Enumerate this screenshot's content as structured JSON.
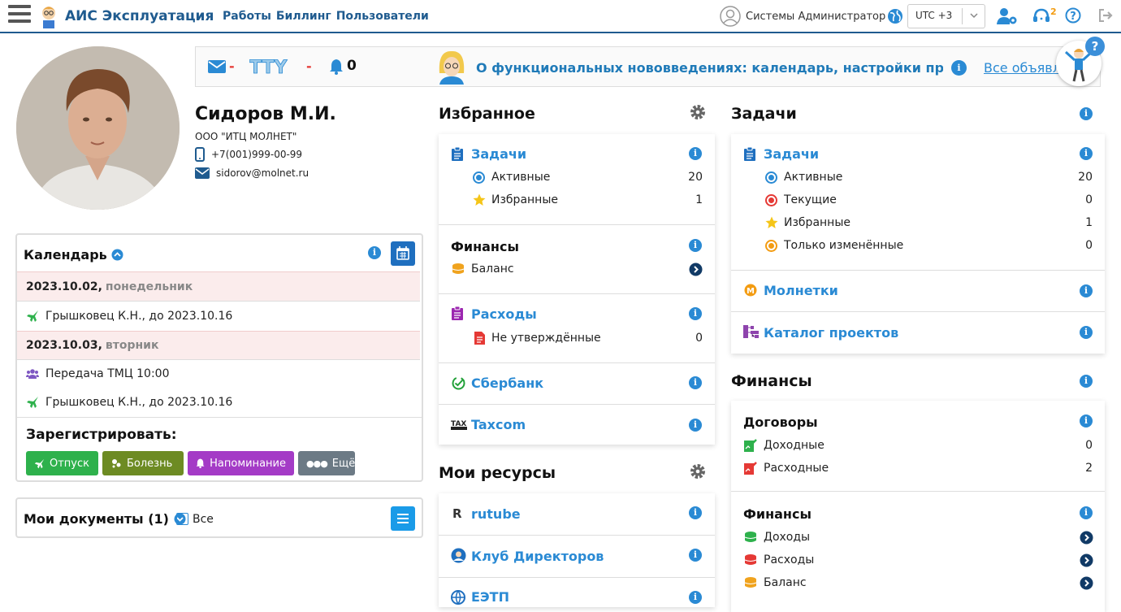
{
  "app": {
    "title": "АИС Эксплуатация"
  },
  "nav": [
    "Работы",
    "Биллинг",
    "Пользователи"
  ],
  "user": {
    "name": "Системы Администратор",
    "timezone": "UTC +3",
    "support_count": "2"
  },
  "banner": {
    "mail_count": "-",
    "tty_count": "-",
    "bell_count": "0",
    "announcement": "О функциональных нововведениях: календарь, настройки про...",
    "all_link": "Все объявления"
  },
  "profile": {
    "name": "Сидоров М.И.",
    "org": "ООО \"ИТЦ МОЛНЕТ\"",
    "phone": "+7(001)999-00-99",
    "email": "sidorov@molnet.ru"
  },
  "calendar": {
    "title": "Календарь",
    "rows": [
      {
        "date": "2023.10.02,",
        "weekday": "понедельник"
      },
      {
        "text": "Грышковец К.Н., до 2023.10.16"
      },
      {
        "date": "2023.10.03,",
        "weekday": "вторник"
      },
      {
        "text": "Передача ТМЦ 10:00"
      },
      {
        "text": "Грышковец К.Н., до 2023.10.16"
      }
    ],
    "register_label": "Зарегистрировать:",
    "buttons": [
      "Отпуск",
      "Болезнь",
      "Напоминание",
      "Ещё"
    ],
    "colors": {
      "vacation": "#2eb14c",
      "sick": "#6d8b23",
      "reminder": "#a43bc6",
      "more": "#6c7a85"
    }
  },
  "documents": {
    "title": "Мои документы (1)",
    "all_label": "Все"
  },
  "favorites": {
    "title": "Избранное",
    "tasks": {
      "title": "Задачи",
      "active_label": "Активные",
      "active_count": "20",
      "fav_label": "Избранные",
      "fav_count": "1"
    },
    "finance": {
      "title": "Финансы",
      "balance_label": "Баланс"
    },
    "expenses": {
      "title": "Расходы",
      "unapproved_label": "Не утверждённые",
      "unapproved_count": "0"
    },
    "sberbank": "Сбербанк",
    "taxcom": "Taxcom"
  },
  "resources": {
    "title": "Мои ресурсы",
    "items": [
      "rutube",
      "Клуб Директоров",
      "ЕЭТП"
    ]
  },
  "tasks": {
    "title": "Задачи",
    "card_title": "Задачи",
    "rows": [
      {
        "label": "Активные",
        "count": "20"
      },
      {
        "label": "Текущие",
        "count": "0"
      },
      {
        "label": "Избранные",
        "count": "1"
      },
      {
        "label": "Только изменённые",
        "count": "0"
      }
    ],
    "molnetki": "Молнетки",
    "projects": "Каталог проектов"
  },
  "finance": {
    "title": "Финансы",
    "contracts": {
      "title": "Договоры",
      "income_label": "Доходные",
      "income_count": "0",
      "expense_label": "Расходные",
      "expense_count": "2"
    },
    "fin": {
      "title": "Финансы",
      "income": "Доходы",
      "expense": "Расходы",
      "balance": "Баланс"
    }
  },
  "accent": "#2a8ad4"
}
